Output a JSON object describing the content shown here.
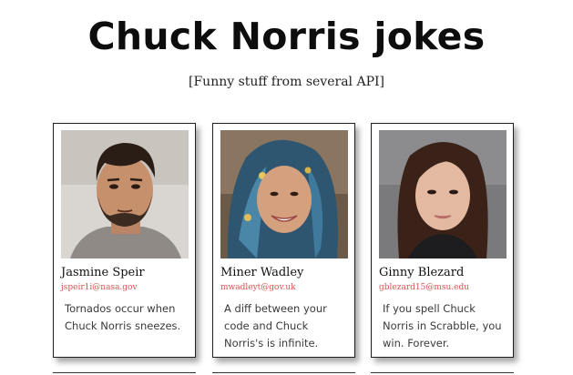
{
  "header": {
    "title": "Chuck Norris jokes",
    "subtitle": "[Funny stuff from several API]"
  },
  "cards": [
    {
      "name": "Jasmine Speir",
      "email": "jspeir1i@nasa.gov",
      "joke": "Tornados occur when Chuck Norris sneezes.",
      "photo_icon": "portrait-man-dark-hair-beard"
    },
    {
      "name": "Miner Wadley",
      "email": "mwadleyt@gov.uk",
      "joke": "A diff between your code and Chuck Norris's is infinite.",
      "photo_icon": "portrait-woman-headscarf-smiling"
    },
    {
      "name": "Ginny Blezard",
      "email": "gblezard15@msu.edu",
      "joke": "If you spell Chuck Norris in Scrabble, you win. Forever.",
      "photo_icon": "portrait-woman-long-hair"
    }
  ]
}
